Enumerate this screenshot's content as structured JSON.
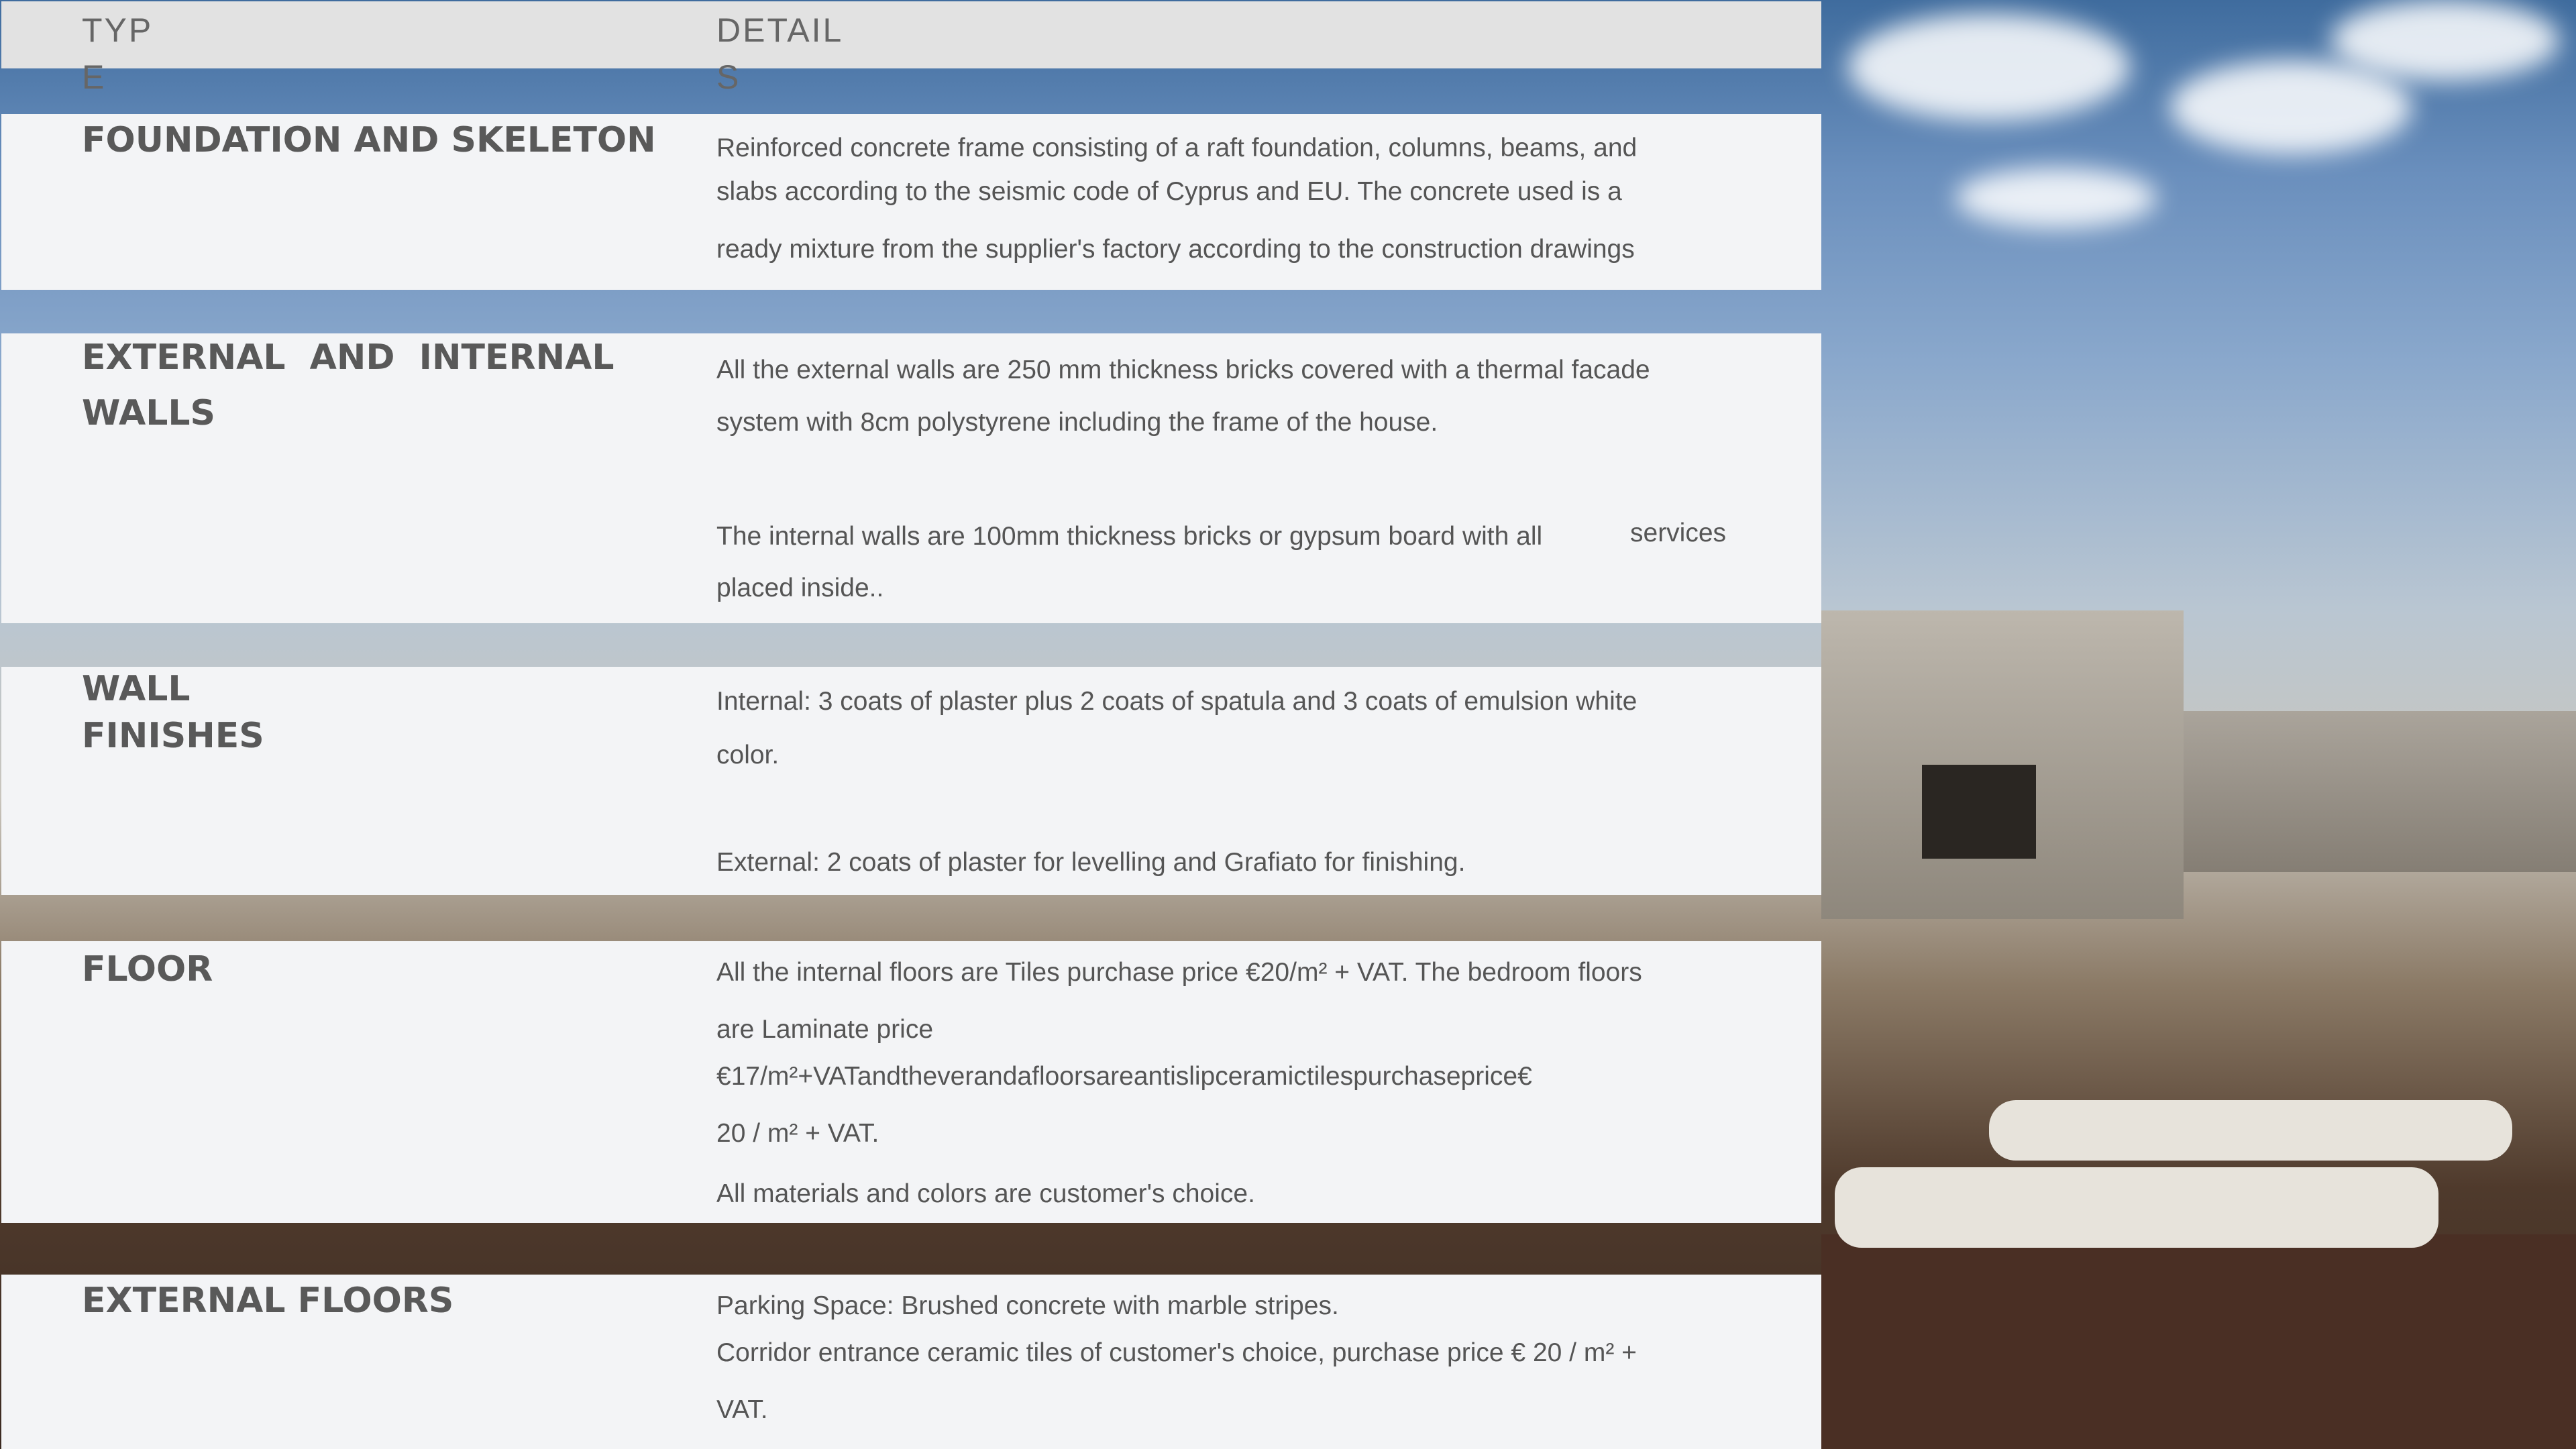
{
  "header": {
    "type_label": "TYPE",
    "details_label": "DETAILS"
  },
  "rows": [
    {
      "type": "FOUNDATION AND SKELETON",
      "lines": [
        "Reinforced concrete frame consisting of a raft foundation, columns, beams, and",
        "slabs according to the seismic code of Cyprus and EU. The concrete used is a",
        "ready mixture from the supplier's factory according to the construction drawings"
      ]
    },
    {
      "type_lines": [
        "EXTERNAL AND INTERNAL",
        "WALLS"
      ],
      "lines": [
        "All the external walls are 250 mm thickness bricks covered with a thermal facade",
        "system with 8cm polystyrene including the frame of the house.",
        "The internal walls are 100mm thickness bricks or gypsum board with all",
        "placed inside.."
      ],
      "overflow_word": "services"
    },
    {
      "type_lines": [
        "WALL",
        "FINISHES"
      ],
      "lines": [
        "Internal: 3 coats of plaster plus 2 coats of spatula and 3 coats of emulsion white",
        "color.",
        "External: 2 coats of plaster for levelling and Grafiato for finishing."
      ]
    },
    {
      "type": "FLOOR",
      "lines": [
        "All the internal floors are Tiles purchase price €20/m² + VAT. The bedroom floors",
        "are Laminate price",
        "€17/m²+VATandtheverandafloorsareantislipceramictilespurchaseprice€",
        "20 / m² + VAT.",
        "All materials and colors are customer's choice."
      ]
    },
    {
      "type": "EXTERNAL FLOORS",
      "lines": [
        "Parking Space: Brushed concrete with marble stripes.",
        "Corridor entrance ceramic tiles of customer's choice, purchase price € 20 / m² +",
        "VAT."
      ]
    }
  ]
}
